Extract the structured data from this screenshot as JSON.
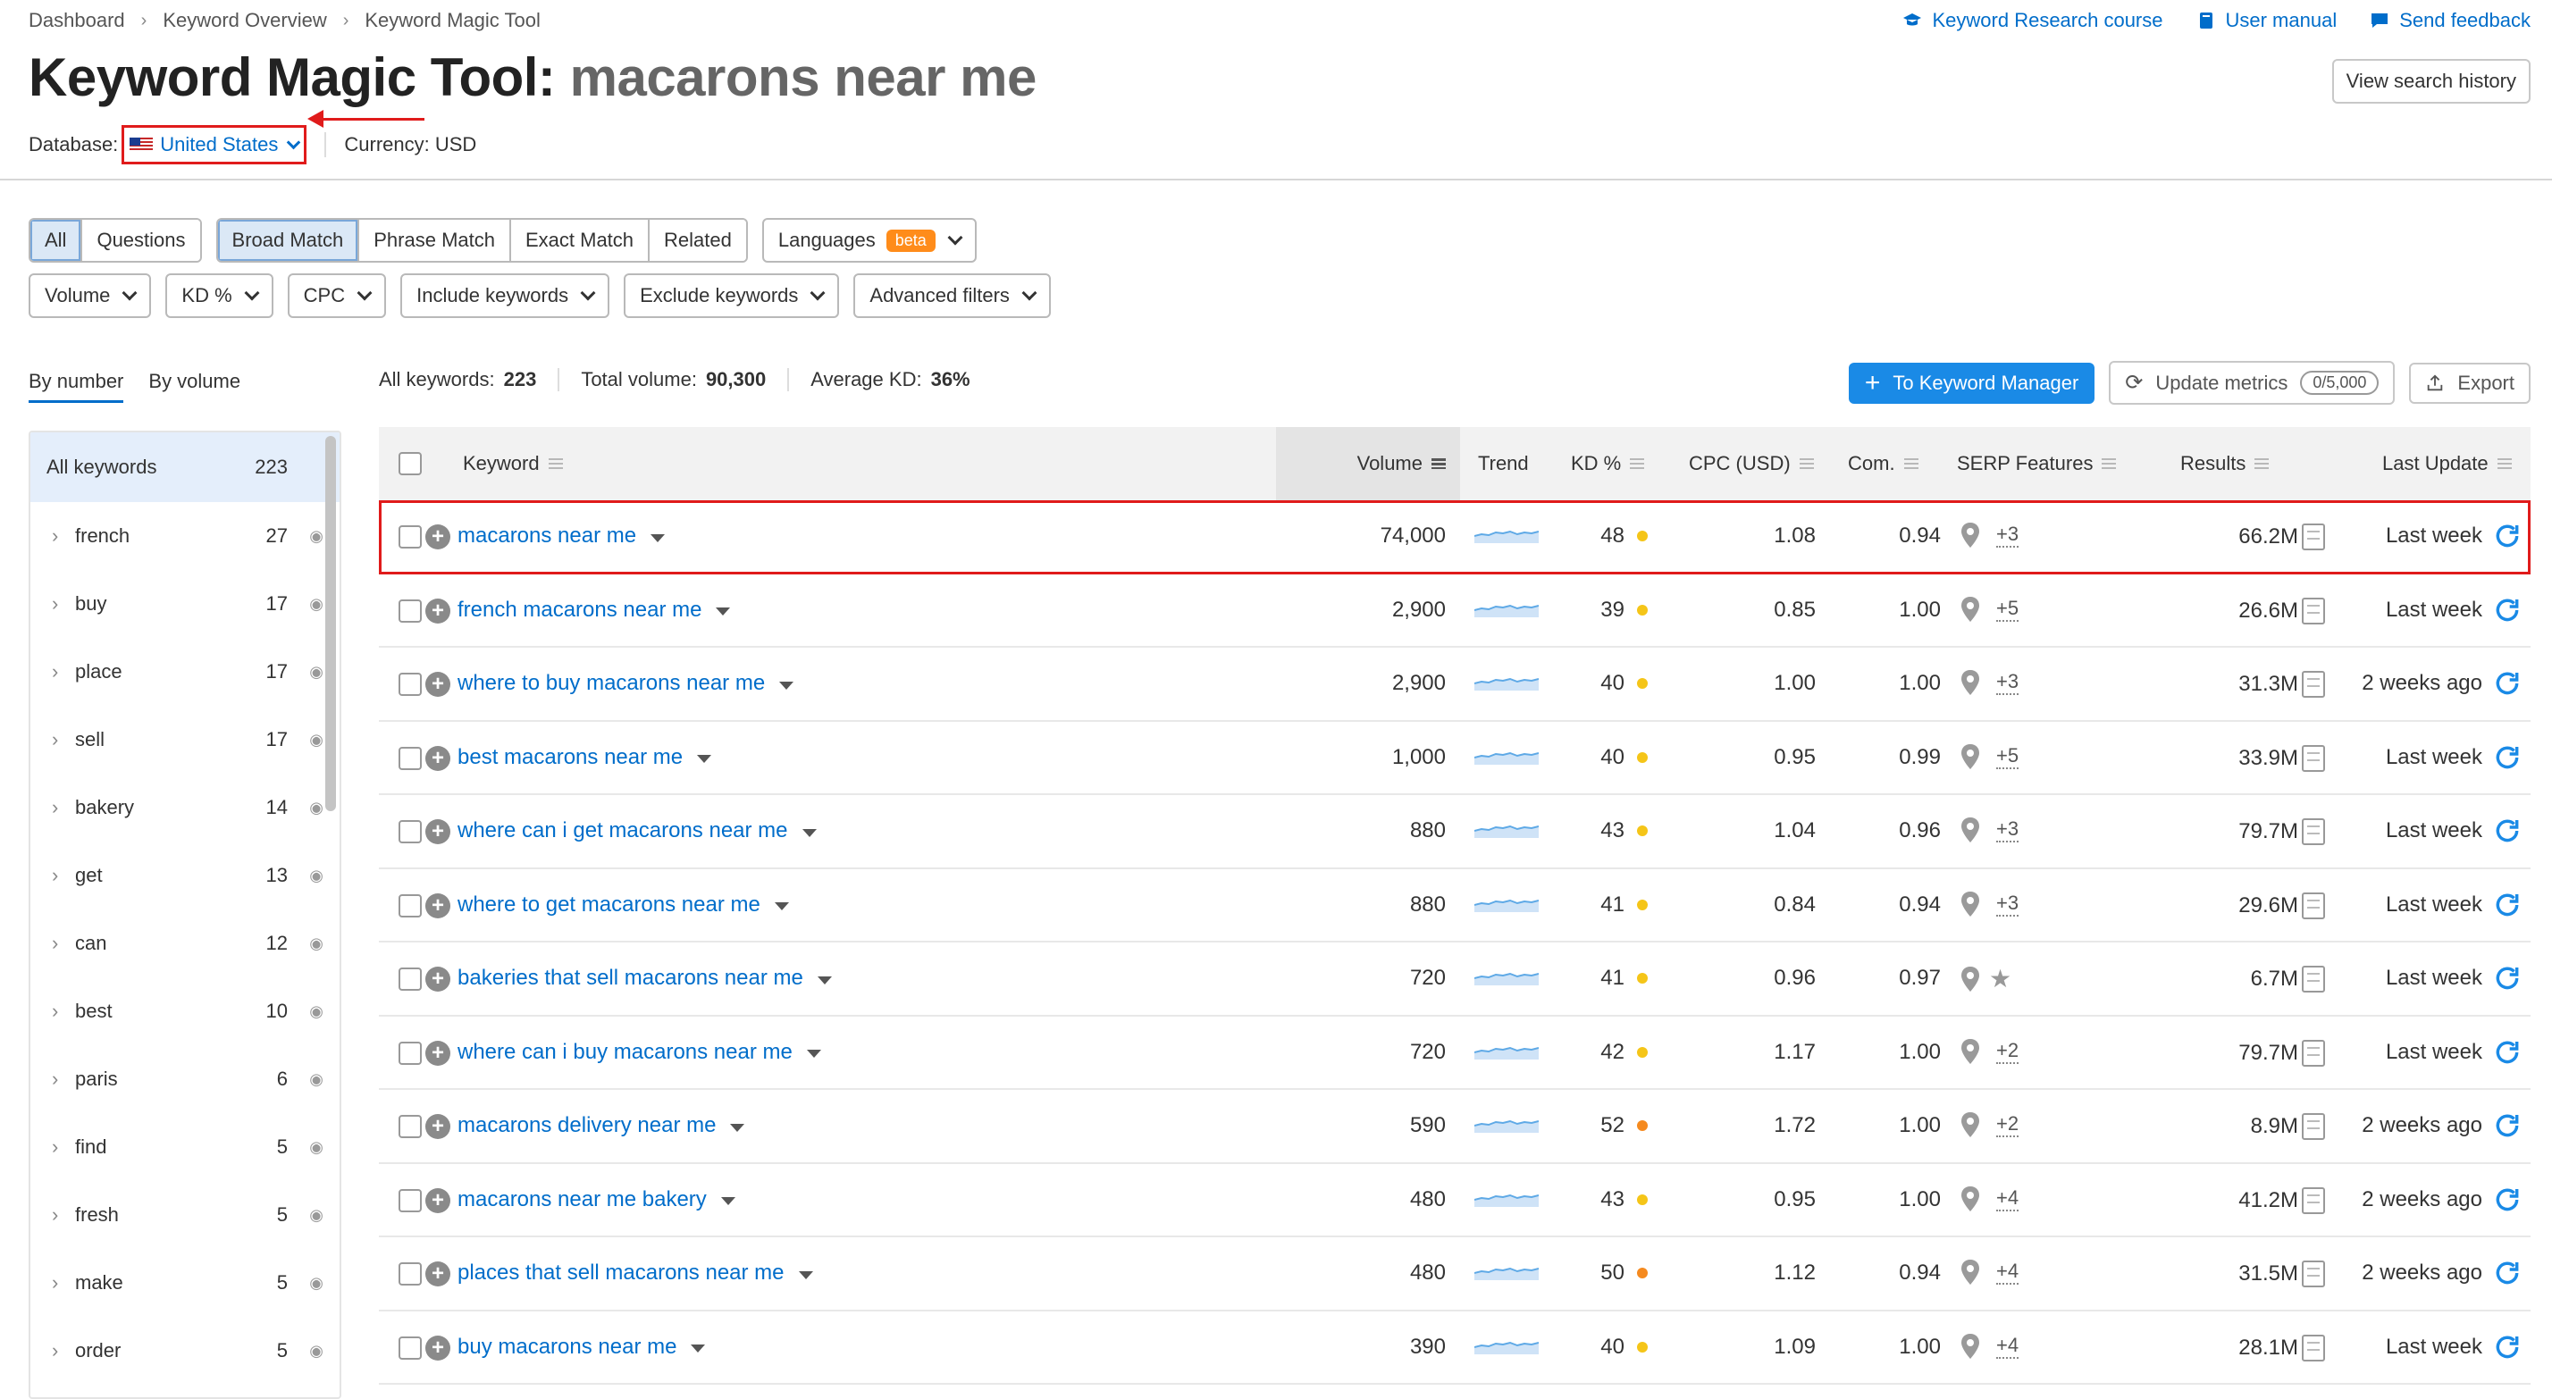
{
  "breadcrumb": [
    "Dashboard",
    "Keyword Overview",
    "Keyword Magic Tool"
  ],
  "top_links": [
    {
      "label": "Keyword Research course",
      "icon": "graduation-cap-icon"
    },
    {
      "label": "User manual",
      "icon": "book-icon"
    },
    {
      "label": "Send feedback",
      "icon": "chat-icon"
    }
  ],
  "title": {
    "prefix": "Keyword Magic Tool:",
    "query": "macarons near me"
  },
  "view_history_label": "View search history",
  "database": {
    "label": "Database:",
    "value": "United States",
    "currency": "Currency: USD"
  },
  "match_tabs": [
    "All",
    "Questions"
  ],
  "match_types": [
    "Broad Match",
    "Phrase Match",
    "Exact Match",
    "Related"
  ],
  "languages": {
    "label": "Languages",
    "badge": "beta"
  },
  "filters": [
    "Volume",
    "KD %",
    "CPC",
    "Include keywords",
    "Exclude keywords",
    "Advanced filters"
  ],
  "side_tabs": [
    "By number",
    "By volume"
  ],
  "sidebar": {
    "all_label": "All keywords",
    "all_count": "223",
    "items": [
      {
        "name": "french",
        "count": "27"
      },
      {
        "name": "buy",
        "count": "17"
      },
      {
        "name": "place",
        "count": "17"
      },
      {
        "name": "sell",
        "count": "17"
      },
      {
        "name": "bakery",
        "count": "14"
      },
      {
        "name": "get",
        "count": "13"
      },
      {
        "name": "can",
        "count": "12"
      },
      {
        "name": "best",
        "count": "10"
      },
      {
        "name": "paris",
        "count": "6"
      },
      {
        "name": "find",
        "count": "5"
      },
      {
        "name": "fresh",
        "count": "5"
      },
      {
        "name": "make",
        "count": "5"
      },
      {
        "name": "order",
        "count": "5"
      }
    ]
  },
  "summary": {
    "all_label": "All keywords:",
    "all_value": "223",
    "volume_label": "Total volume:",
    "volume_value": "90,300",
    "kd_label": "Average KD:",
    "kd_value": "36%"
  },
  "actions": {
    "to_manager": "To Keyword Manager",
    "update": "Update metrics",
    "quota": "0/5,000",
    "export": "Export"
  },
  "columns": [
    "Keyword",
    "Volume",
    "Trend",
    "KD %",
    "CPC (USD)",
    "Com.",
    "SERP Features",
    "Results",
    "Last Update"
  ],
  "colors": {
    "kd_yellow": "#f5c518",
    "kd_orange": "#f58a1f",
    "link": "#006dca",
    "highlight": "#e01b1b"
  },
  "rows": [
    {
      "keyword": "macarons near me",
      "volume": "74,000",
      "kd": "48",
      "kd_color": "#f5c518",
      "cpc": "1.08",
      "com": "0.94",
      "serp": "+3",
      "results": "66.2M",
      "updated": "Last week"
    },
    {
      "keyword": "french macarons near me",
      "volume": "2,900",
      "kd": "39",
      "kd_color": "#f5c518",
      "cpc": "0.85",
      "com": "1.00",
      "serp": "+5",
      "results": "26.6M",
      "updated": "Last week"
    },
    {
      "keyword": "where to buy macarons near me",
      "volume": "2,900",
      "kd": "40",
      "kd_color": "#f5c518",
      "cpc": "1.00",
      "com": "1.00",
      "serp": "+3",
      "results": "31.3M",
      "updated": "2 weeks ago"
    },
    {
      "keyword": "best macarons near me",
      "volume": "1,000",
      "kd": "40",
      "kd_color": "#f5c518",
      "cpc": "0.95",
      "com": "0.99",
      "serp": "+5",
      "results": "33.9M",
      "updated": "Last week"
    },
    {
      "keyword": "where can i get macarons near me",
      "volume": "880",
      "kd": "43",
      "kd_color": "#f5c518",
      "cpc": "1.04",
      "com": "0.96",
      "serp": "+3",
      "results": "79.7M",
      "updated": "Last week"
    },
    {
      "keyword": "where to get macarons near me",
      "volume": "880",
      "kd": "41",
      "kd_color": "#f5c518",
      "cpc": "0.84",
      "com": "0.94",
      "serp": "+3",
      "results": "29.6M",
      "updated": "Last week"
    },
    {
      "keyword": "bakeries that sell macarons near me",
      "volume": "720",
      "kd": "41",
      "kd_color": "#f5c518",
      "cpc": "0.96",
      "com": "0.97",
      "serp": "star",
      "results": "6.7M",
      "updated": "Last week"
    },
    {
      "keyword": "where can i buy macarons near me",
      "volume": "720",
      "kd": "42",
      "kd_color": "#f5c518",
      "cpc": "1.17",
      "com": "1.00",
      "serp": "+2",
      "results": "79.7M",
      "updated": "Last week"
    },
    {
      "keyword": "macarons delivery near me",
      "volume": "590",
      "kd": "52",
      "kd_color": "#f58a1f",
      "cpc": "1.72",
      "com": "1.00",
      "serp": "+2",
      "results": "8.9M",
      "updated": "2 weeks ago"
    },
    {
      "keyword": "macarons near me bakery",
      "volume": "480",
      "kd": "43",
      "kd_color": "#f5c518",
      "cpc": "0.95",
      "com": "1.00",
      "serp": "+4",
      "results": "41.2M",
      "updated": "2 weeks ago"
    },
    {
      "keyword": "places that sell macarons near me",
      "volume": "480",
      "kd": "50",
      "kd_color": "#f58a1f",
      "cpc": "1.12",
      "com": "0.94",
      "serp": "+4",
      "results": "31.5M",
      "updated": "2 weeks ago"
    },
    {
      "keyword": "buy macarons near me",
      "volume": "390",
      "kd": "40",
      "kd_color": "#f5c518",
      "cpc": "1.09",
      "com": "1.00",
      "serp": "+4",
      "results": "28.1M",
      "updated": "Last week"
    }
  ]
}
